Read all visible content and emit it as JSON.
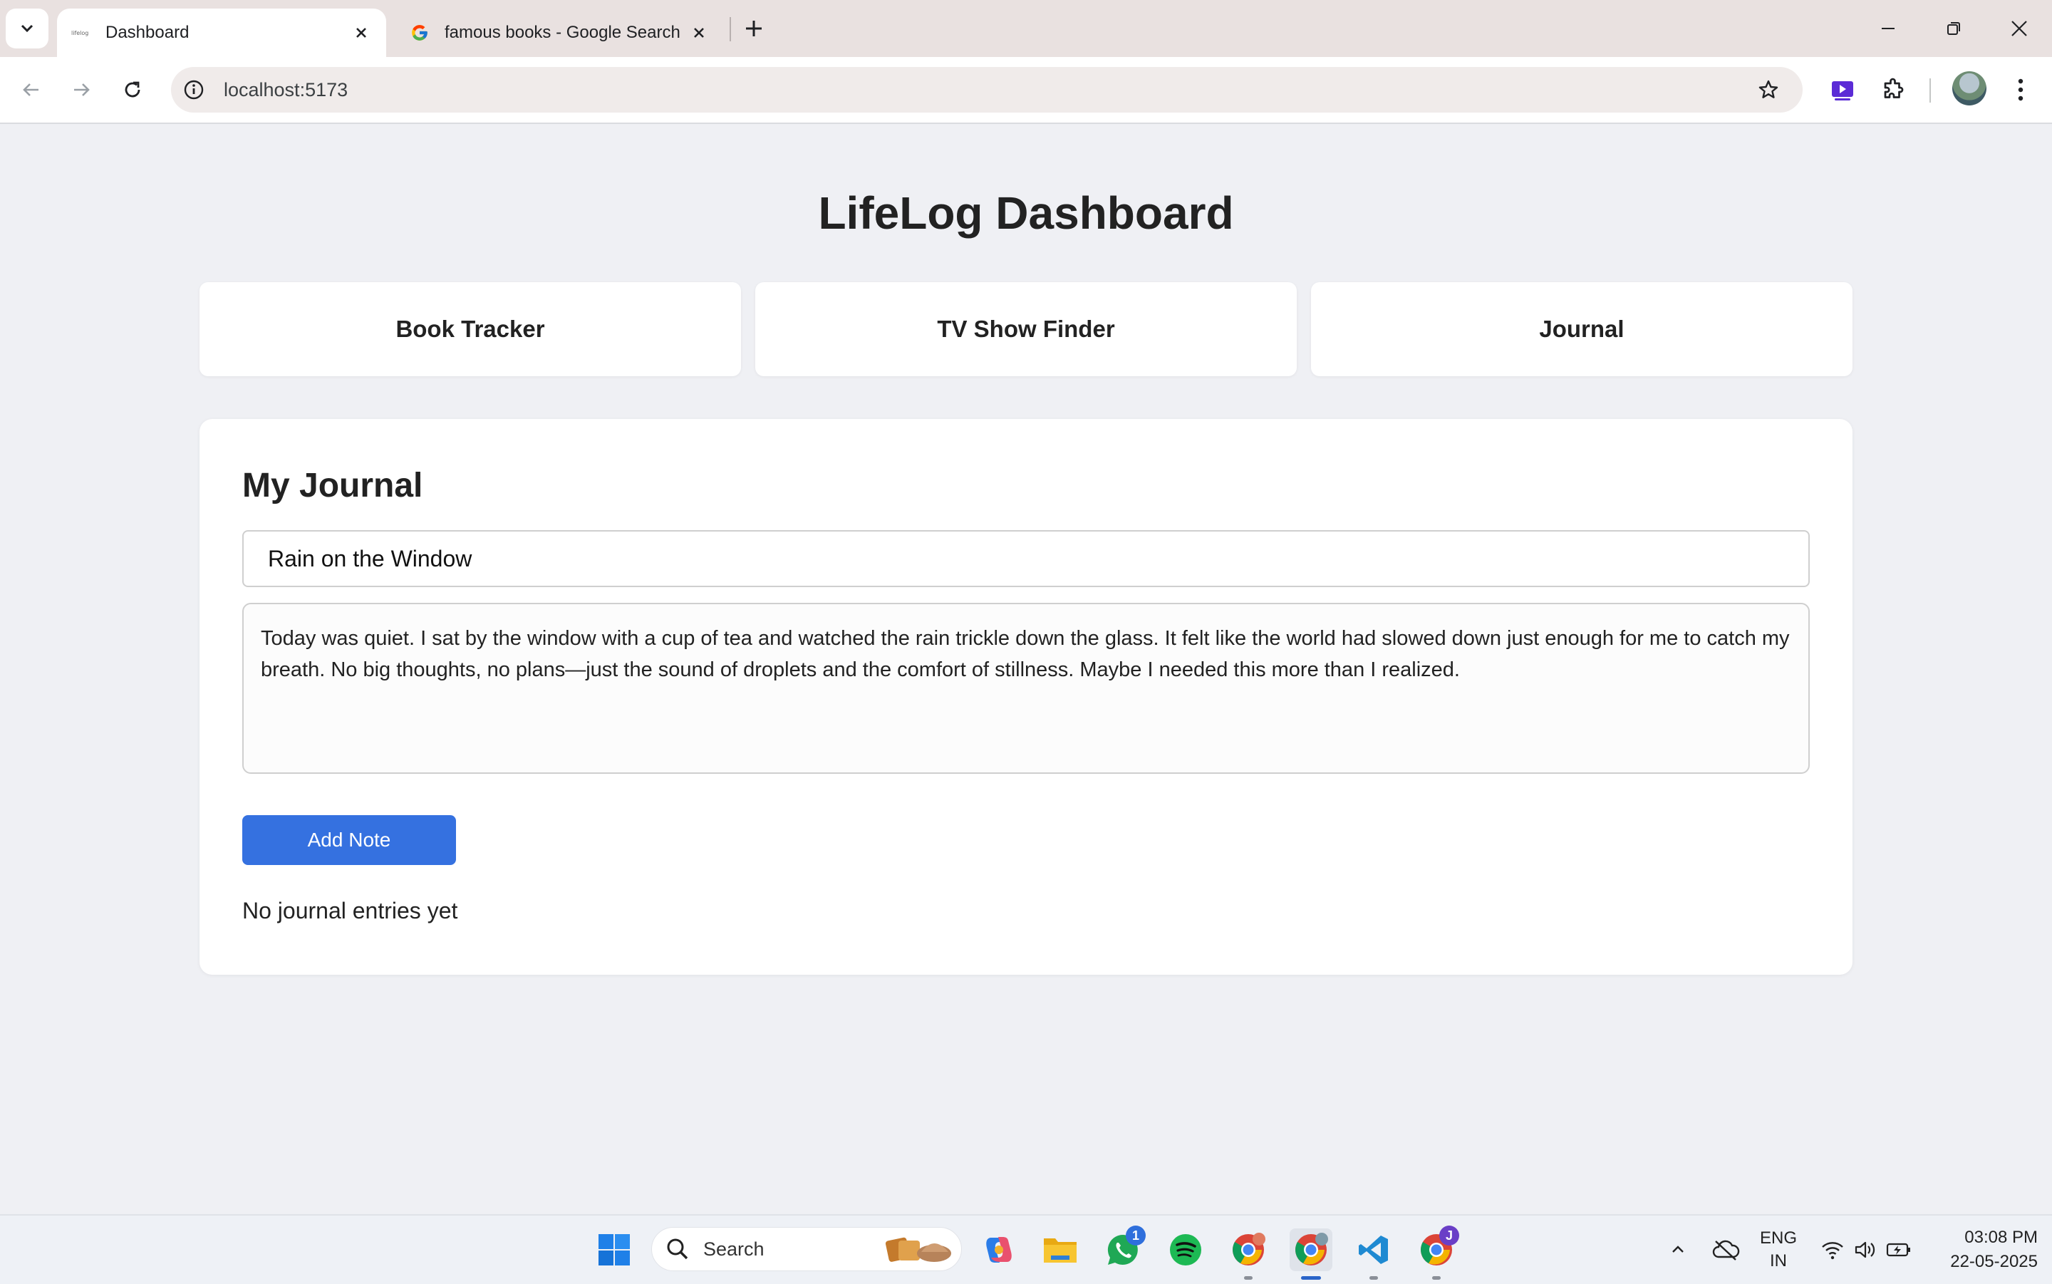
{
  "browser": {
    "tabs": [
      {
        "title": "Dashboard",
        "favicon": "lifelog-favicon",
        "active": true
      },
      {
        "title": "famous books - Google Search",
        "favicon": "google-g-icon",
        "active": false
      }
    ],
    "url": "localhost:5173"
  },
  "app": {
    "title": "LifeLog Dashboard",
    "nav": {
      "book_tracker": "Book Tracker",
      "tv_show_finder": "TV Show Finder",
      "journal": "Journal"
    },
    "journal": {
      "heading": "My Journal",
      "title_value": "Rain on the Window",
      "body_value": "Today was quiet. I sat by the window with a cup of tea and watched the rain trickle down the glass. It felt like the world had slowed down just enough for me to catch my breath. No big thoughts, no plans—just the sound of droplets and the comfort of stillness. Maybe I needed this more than I realized.",
      "add_button": "Add Note",
      "empty_message": "No journal entries yet"
    }
  },
  "taskbar": {
    "search_label": "Search",
    "whatsapp_badge": "1",
    "chrome_profile_badge": "J",
    "language": {
      "line1": "ENG",
      "line2": "IN"
    },
    "time": "03:08 PM",
    "date": "22-05-2025"
  },
  "colors": {
    "accent_button": "#3571e0",
    "page_background": "#eff0f4"
  }
}
